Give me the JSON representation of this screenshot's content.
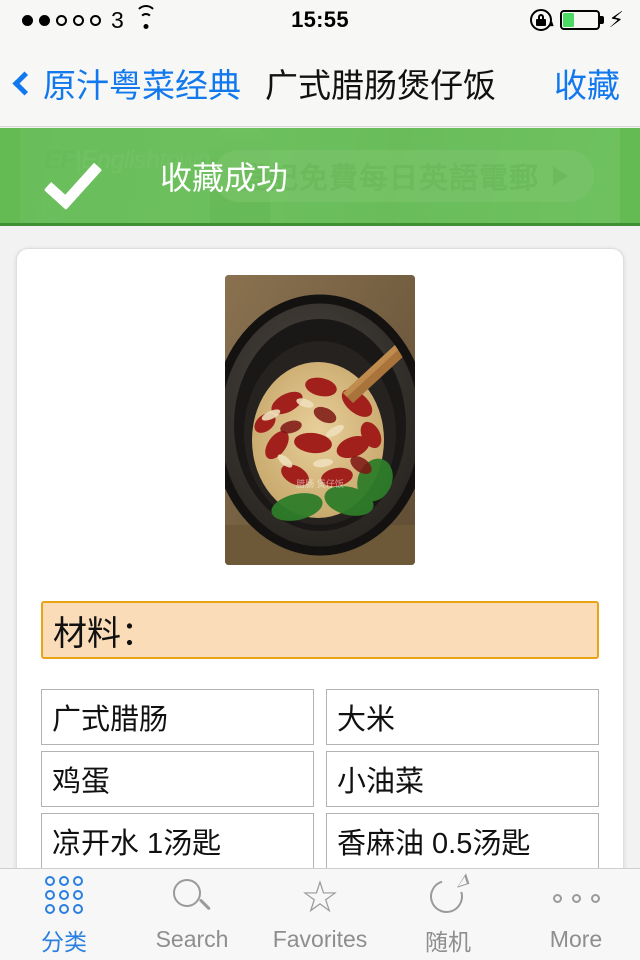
{
  "status_bar": {
    "signal_dots_filled": 2,
    "signal_dots_total": 5,
    "carrier": "3",
    "wifi_icon": "wifi-icon",
    "time": "15:55",
    "rotation_lock_icon": "rotation-lock-icon",
    "battery_percent": 35,
    "charging_icon": "lightning-bolt-icon"
  },
  "nav_bar": {
    "back_icon": "chevron-left-icon",
    "back_label": "原汁粤菜经典",
    "title": "广式腊肠煲仔饭",
    "action_label": "收藏",
    "tint_color": "#1278ed"
  },
  "banner": {
    "ad_logo_bold": "EF",
    "ad_logo_separator": "|",
    "ad_logo_thin": "Englishtown",
    "ad_cta_text": "登記免費每日英語電郵",
    "ad_cta_arrow": "play-arrow-icon"
  },
  "toast": {
    "check_icon": "checkmark-icon",
    "message": "收藏成功",
    "background_color": "#5dba4d",
    "text_color": "#ffffff"
  },
  "recipe": {
    "photo_alt": "广式腊肠煲仔饭 claypot rice photo",
    "section_title": "材料：",
    "section_bg_color": "#fbdcb8",
    "section_border_color": "#e8a317",
    "ingredients": [
      "广式腊肠",
      "大米",
      "鸡蛋",
      "小油菜",
      "凉开水 1汤匙",
      "香麻油 0.5汤匙"
    ]
  },
  "tab_bar": {
    "active_index": 0,
    "active_color": "#2a7fe0",
    "inactive_color": "#8e8e8e",
    "tabs": [
      {
        "label": "分类",
        "icon": "grid-icon"
      },
      {
        "label": "Search",
        "icon": "search-icon"
      },
      {
        "label": "Favorites",
        "icon": "star-icon"
      },
      {
        "label": "随机",
        "icon": "refresh-icon"
      },
      {
        "label": "More",
        "icon": "more-dots-icon"
      }
    ]
  }
}
